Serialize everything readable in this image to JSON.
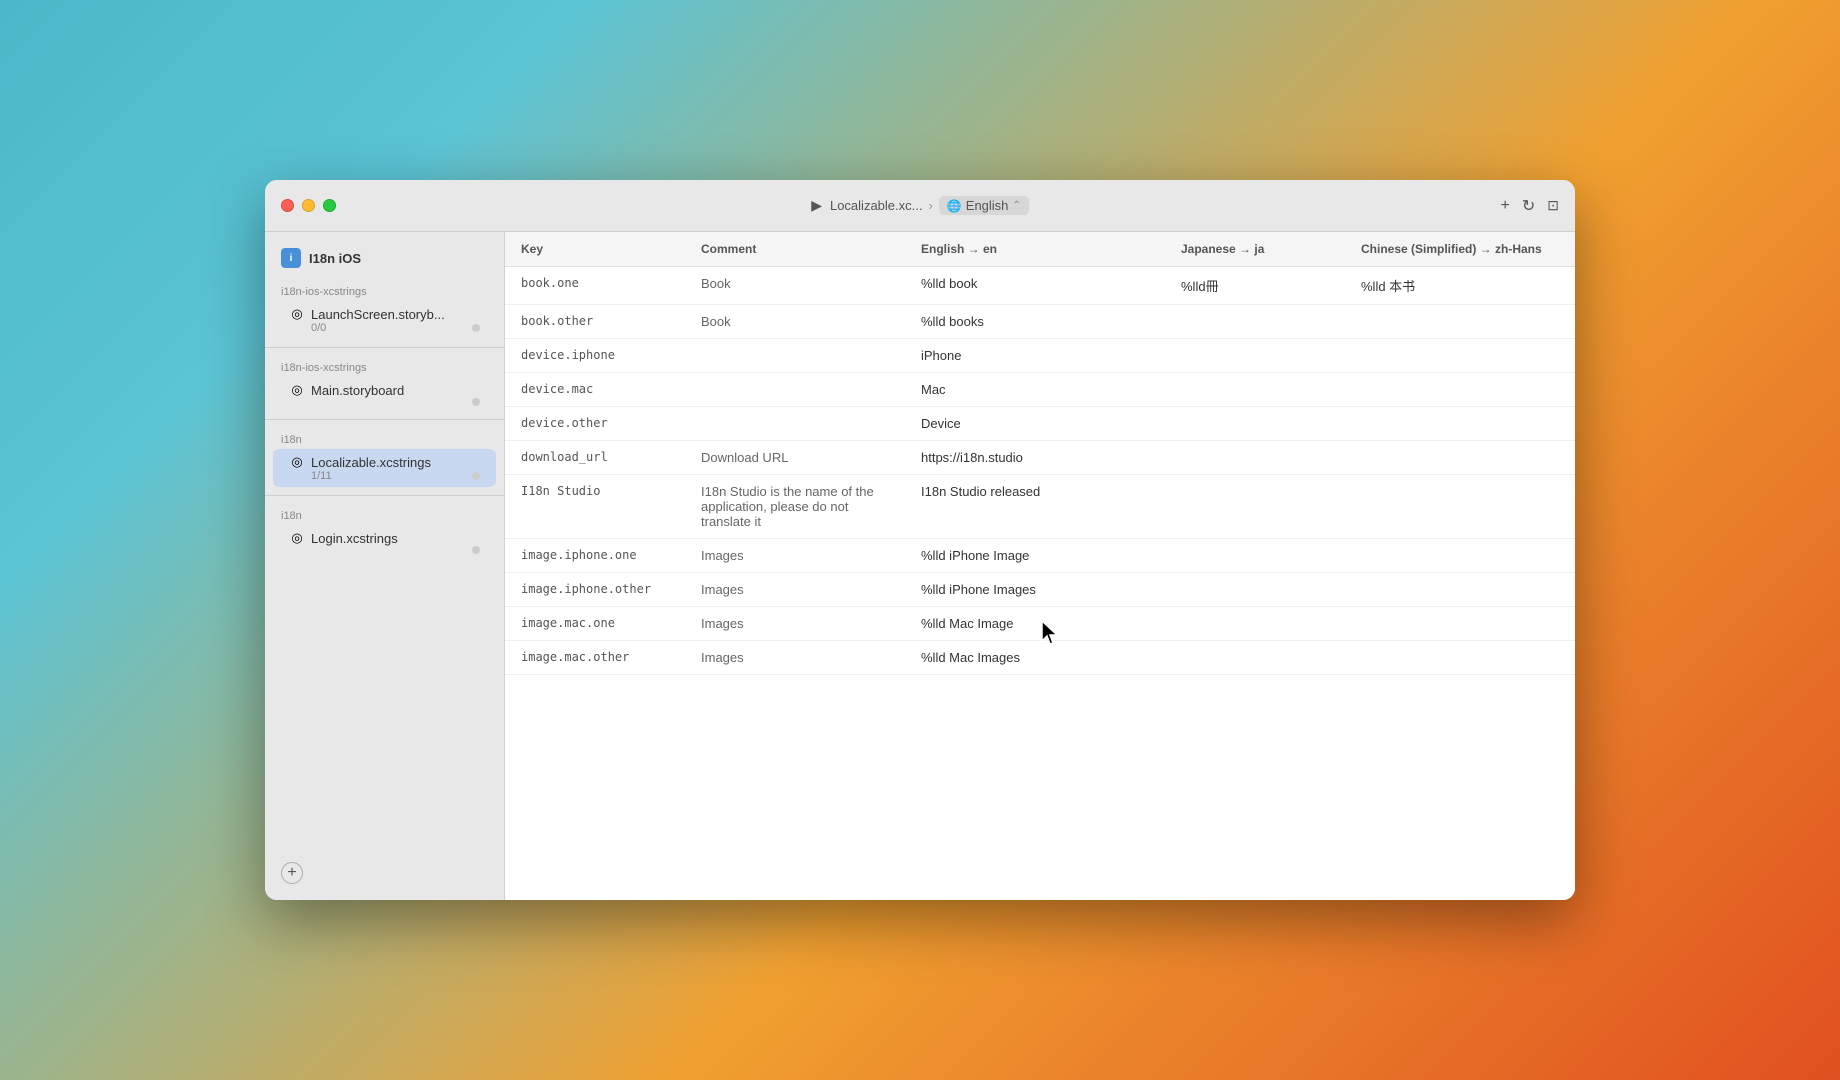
{
  "window": {
    "title": "I18n iOS"
  },
  "titlebar": {
    "play_button": "▶",
    "breadcrumb_file": "Localizable.xc...",
    "breadcrumb_separator": "›",
    "breadcrumb_current": "English",
    "chevron": "⌃",
    "plus_icon": "+",
    "refresh_icon": "↻",
    "layout_icon": "⊡"
  },
  "sidebar": {
    "project_name": "I18n iOS",
    "sections": [
      {
        "label": "i18n-ios-xcstrings",
        "items": [
          {
            "name": "LaunchScreen.storyb...",
            "icon": "◎",
            "progress": "0/0",
            "dot": true
          }
        ]
      },
      {
        "label": "i18n-ios-xcstrings",
        "items": [
          {
            "name": "Main.storyboard",
            "icon": "◎",
            "progress": "",
            "dot": true
          }
        ]
      },
      {
        "label": "i18n",
        "items": [
          {
            "name": "Localizable.xcstrings",
            "icon": "◎",
            "progress": "1/11",
            "dot": true,
            "active": true
          }
        ]
      },
      {
        "label": "i18n",
        "items": [
          {
            "name": "Login.xcstrings",
            "icon": "◎",
            "progress": "",
            "dot": true
          }
        ]
      }
    ],
    "add_button": "+"
  },
  "table": {
    "columns": [
      {
        "id": "key",
        "label": "Key"
      },
      {
        "id": "comment",
        "label": "Comment"
      },
      {
        "id": "english",
        "label": "English → en"
      },
      {
        "id": "japanese",
        "label": "Japanese → ja"
      },
      {
        "id": "chinese",
        "label": "Chinese (Simplified) → zh-Hans"
      }
    ],
    "rows": [
      {
        "key": "book.one",
        "comment": "Book",
        "english": "%lld book",
        "japanese": "%lld冊",
        "chinese": "%lld 本书"
      },
      {
        "key": "book.other",
        "comment": "Book",
        "english": "%lld books",
        "japanese": "",
        "chinese": ""
      },
      {
        "key": "device.iphone",
        "comment": "",
        "english": "iPhone",
        "japanese": "",
        "chinese": ""
      },
      {
        "key": "device.mac",
        "comment": "",
        "english": "Mac",
        "japanese": "",
        "chinese": ""
      },
      {
        "key": "device.other",
        "comment": "",
        "english": "Device",
        "japanese": "",
        "chinese": ""
      },
      {
        "key": "download_url",
        "comment": "Download URL",
        "english": "https://i18n.studio",
        "japanese": "",
        "chinese": ""
      },
      {
        "key": "I18n Studio",
        "comment": "I18n Studio is the name of the application, please do not translate it",
        "english": "I18n Studio released",
        "japanese": "",
        "chinese": ""
      },
      {
        "key": "image.iphone.one",
        "comment": "Images",
        "english": "%lld iPhone Image",
        "japanese": "",
        "chinese": ""
      },
      {
        "key": "image.iphone.other",
        "comment": "Images",
        "english": "%lld iPhone Images",
        "japanese": "",
        "chinese": ""
      },
      {
        "key": "image.mac.one",
        "comment": "Images",
        "english": "%lld Mac Image",
        "japanese": "",
        "chinese": ""
      },
      {
        "key": "image.mac.other",
        "comment": "Images",
        "english": "%lld Mac Images",
        "japanese": "",
        "chinese": ""
      }
    ]
  }
}
